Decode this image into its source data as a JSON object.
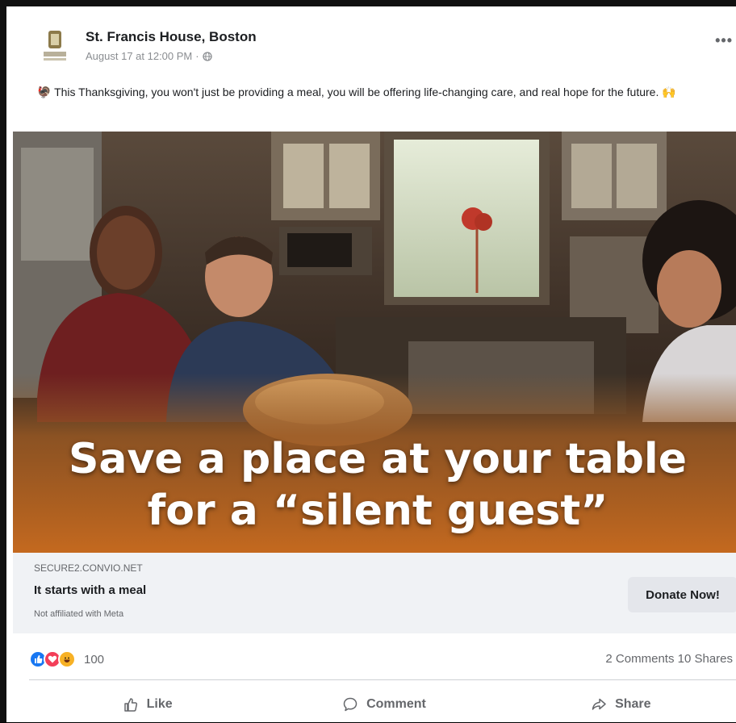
{
  "post": {
    "page_name": "St. Francis House, Boston",
    "timestamp": "August 17 at 12:00 PM",
    "privacy_icon": "globe-icon",
    "more_label": "•••",
    "text": "This Thanksgiving, you won't just be providing a meal, you will be offering life-changing care, and real hope for the future.",
    "text_emoji_start": "🦃",
    "text_emoji_end": "🙌"
  },
  "image": {
    "headline_line1": "Save a place at your table",
    "headline_line2": "for a “silent guest”"
  },
  "link_preview": {
    "domain": "SECURE2.CONVIO.NET",
    "title": "It starts with a meal",
    "disclaimer": "Not affiliated with Meta",
    "cta_label": "Donate Now!"
  },
  "reactions": {
    "icons": [
      "like-icon",
      "love-icon",
      "haha-icon"
    ],
    "count": "100",
    "comments_shares": "2 Comments  10 Shares"
  },
  "actions": {
    "like": "Like",
    "comment": "Comment",
    "share": "Share"
  },
  "colors": {
    "like_blue": "#1877f2",
    "love_red": "#f33e58",
    "haha_yellow": "#f7b125",
    "cta_bg": "#e4e6eb"
  }
}
